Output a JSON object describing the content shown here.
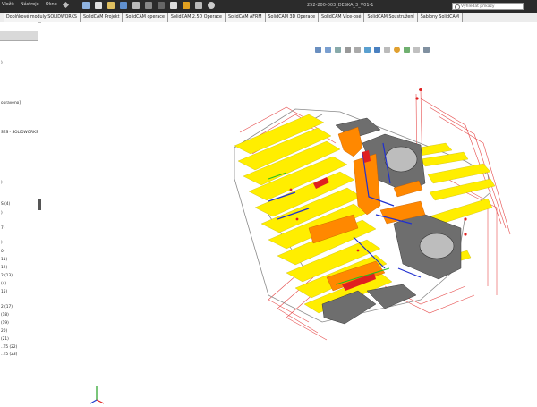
{
  "menu": {
    "items": [
      "Vložit",
      "Nástroje",
      "Okno"
    ]
  },
  "document_title": "252-200-003_DESKA_3_V01-1",
  "search": {
    "placeholder": "Vyhledat příkazy"
  },
  "tabs": [
    {
      "label": "Doplňkové moduly SOLIDWORKS"
    },
    {
      "label": "SolidCAM Projekt"
    },
    {
      "label": "SolidCAM operace"
    },
    {
      "label": "SolidCAM 2.5D Operace"
    },
    {
      "label": "SolidCAM AFRM"
    },
    {
      "label": "SolidCAM 3D Operace"
    },
    {
      "label": "SolidCAM Více-osé"
    },
    {
      "label": "SolidCAM Soustružení"
    },
    {
      "label": "Šablony SolidCAM"
    }
  ],
  "tree": {
    "lines": [
      ")",
      "opraveno]",
      "SES - SOLIDWORKS",
      ")",
      "S (4)",
      ")",
      "7)",
      ")",
      "0)",
      "11)",
      "12)",
      "2 (13)",
      "(4)",
      "15)",
      "2 (17)",
      "(18)",
      "(19)",
      "20)",
      "(21)",
      "..T5 (22)",
      "..T5 (23)"
    ]
  },
  "colors": {
    "toolpath_yellow": "#ffee00",
    "toolpath_orange": "#ff8800",
    "toolpath_red": "#e02020",
    "part_gray": "#6e6e6e",
    "bbox_gray": "#8a8a8a",
    "blue": "#2030d0",
    "green": "#20c020"
  }
}
